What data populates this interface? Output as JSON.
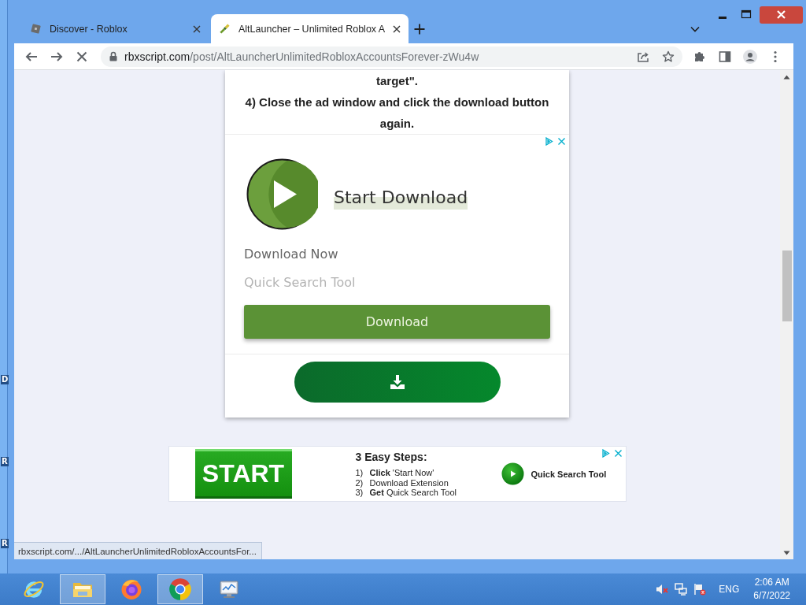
{
  "desktop": {
    "icon_labels": [
      "D",
      "R",
      "R"
    ]
  },
  "browser": {
    "tabs": [
      {
        "title": "Discover - Roblox",
        "selected": false,
        "kind": "roblox"
      },
      {
        "title": "AltLauncher – Unlimited Roblox A",
        "selected": true,
        "kind": "site"
      }
    ],
    "toolbar": {
      "loading": true,
      "host": "rbxscript.com",
      "path": "/post/AltLauncherUnlimitedRobloxAccountsForever-zWu4w"
    },
    "status_url": "rbxscript.com/.../AltLauncherUnlimitedRobloxAccountsFor..."
  },
  "page": {
    "instructions": [
      "target\".",
      "4) Close the ad window and click the download button again."
    ],
    "ad": {
      "title": "Start Download",
      "subtitle": "Download Now",
      "tagline": "Quick Search Tool",
      "button": "Download"
    },
    "banner": {
      "start_label": "START",
      "heading": "3 Easy Steps:",
      "steps": [
        {
          "number": "1)",
          "text": "**Click** 'Start Now'"
        },
        {
          "number": "2)",
          "text": "Download Extension"
        },
        {
          "number": "3)",
          "text": "**Get** Quick Search Tool"
        }
      ],
      "cta": "Quick Search Tool"
    }
  },
  "taskbar": {
    "apps": [
      {
        "kind": "ie",
        "running": false
      },
      {
        "kind": "explorer",
        "running": true
      },
      {
        "kind": "firefox",
        "running": false
      },
      {
        "kind": "chrome",
        "running": true
      },
      {
        "kind": "monitor",
        "running": false
      }
    ],
    "language": "ENG",
    "time": "2:06 AM",
    "date": "6/7/2022"
  }
}
